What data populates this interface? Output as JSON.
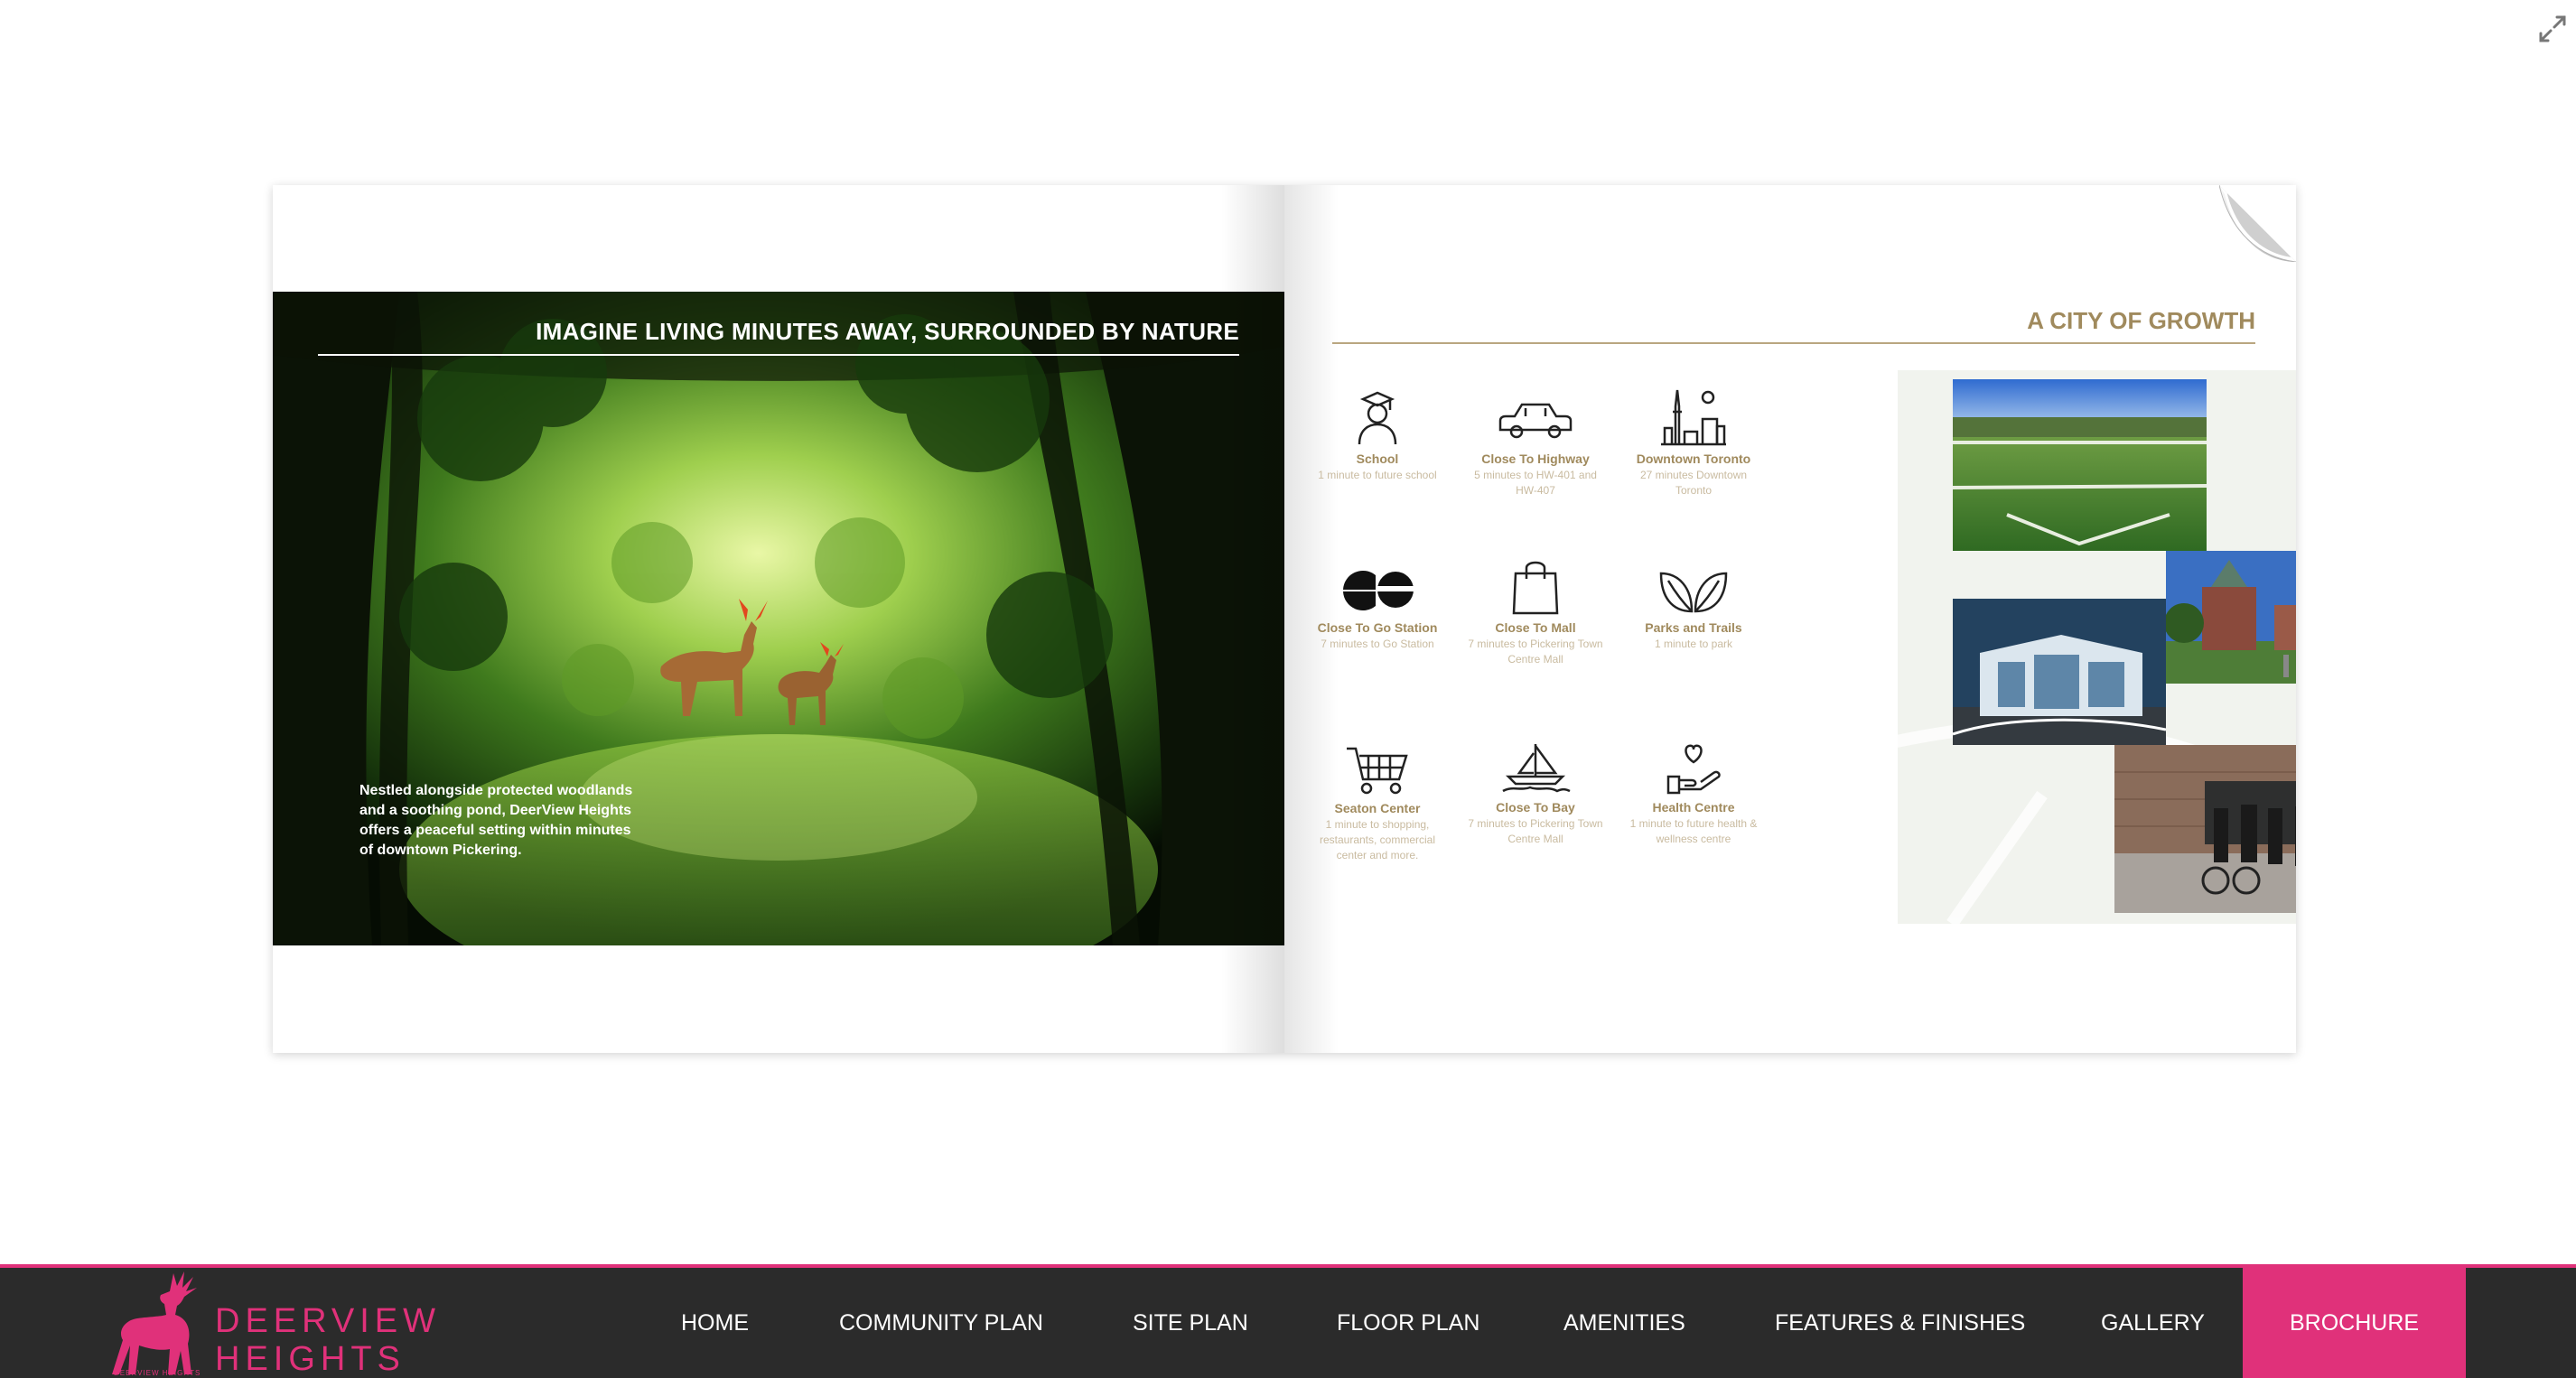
{
  "viewer": {
    "fullscreen_icon": "expand-arrows-icon"
  },
  "left_page": {
    "title": "IMAGINE LIVING MINUTES AWAY, SURROUNDED BY NATURE",
    "body": "Nestled alongside protected woodlands and a soothing pond, DeerView Heights offers a peaceful setting within minutes of downtown Pickering."
  },
  "right_page": {
    "title": "A CITY OF GROWTH",
    "amenities": [
      {
        "title": "School",
        "desc": "1 minute to future school",
        "icon": "graduate-icon"
      },
      {
        "title": "Close To Highway",
        "desc": "5 minutes to HW-401 and HW-407",
        "icon": "car-icon"
      },
      {
        "title": "Downtown Toronto",
        "desc": "27 minutes Downtown Toronto",
        "icon": "city-skyline-icon"
      },
      {
        "title": "Close To Go Station",
        "desc": "7 minutes to Go Station",
        "icon": "go-transit-icon"
      },
      {
        "title": "Close To Mall",
        "desc": "7 minutes to Pickering Town Centre Mall",
        "icon": "shopping-bag-icon"
      },
      {
        "title": "Parks and Trails",
        "desc": "1 minute to park",
        "icon": "leaves-icon"
      },
      {
        "title": "Seaton Center",
        "desc": "1 minute to shopping, restaurants, commercial center and more.",
        "icon": "shopping-cart-icon"
      },
      {
        "title": "Close To Bay",
        "desc": "7 minutes to Pickering Town Centre Mall",
        "icon": "sailboat-icon"
      },
      {
        "title": "Health Centre",
        "desc": "1 minute to future health & wellness centre",
        "icon": "heart-hand-icon"
      }
    ]
  },
  "nav": {
    "logo_text": "DEERVIEW\nHEIGHTS",
    "logo_sub": "DEERVIEW HEIGHTS",
    "items": [
      "HOME",
      "COMMUNITY PLAN",
      "SITE PLAN",
      "FLOOR PLAN",
      "AMENITIES",
      "FEATURES & FINISHES",
      "GALLERY",
      "BROCHURE"
    ],
    "active": "BROCHURE"
  },
  "colors": {
    "accent_pink": "#e0317a",
    "gold": "#a08a5d",
    "navbar_bg": "#2b2b2b"
  }
}
